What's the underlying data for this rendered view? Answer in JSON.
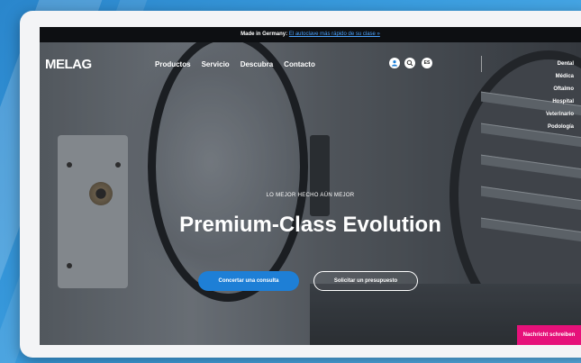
{
  "topbar": {
    "prefix": "Made in Germany:",
    "link": "El autoclave más rápido de su clase »"
  },
  "header": {
    "logo": "MELAG",
    "nav": [
      "Productos",
      "Servicio",
      "Descubra",
      "Contacto"
    ],
    "language": "ES"
  },
  "sidebar": {
    "items": [
      "Dental",
      "Médica",
      "Oftalmo",
      "Hospital",
      "Veterinario",
      "Podología"
    ]
  },
  "hero": {
    "kicker": "LO MEJOR HECHO AÚN MEJOR",
    "title": "Premium-Class Evolution",
    "primary_button": "Concertar una consulta",
    "secondary_button": "Solicitar un presupuesto"
  },
  "chat_button": "Nachricht schreiben",
  "colors": {
    "accent": "#1e7fd6",
    "chat": "#e6117a",
    "background": "#3b9ee0"
  }
}
